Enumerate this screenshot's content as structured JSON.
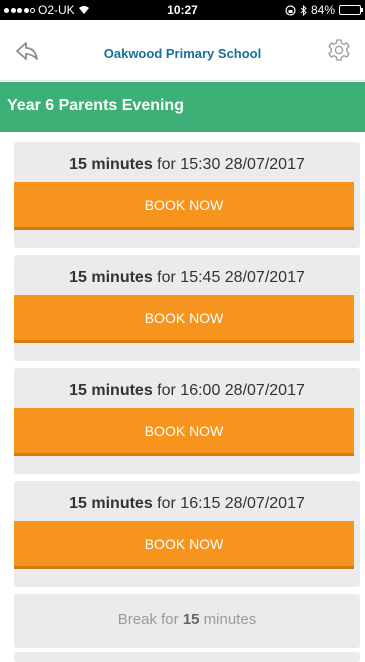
{
  "status_bar": {
    "carrier": "O2-UK",
    "time": "10:27",
    "battery": "84%",
    "battery_level": 0.84
  },
  "nav": {
    "title": "Oakwood Primary School",
    "back_icon": "back-arrow-icon",
    "settings_icon": "gear-icon",
    "title_color": "#1b6e96"
  },
  "header": {
    "title": "Year 6 Parents Evening",
    "color": "#3db077"
  },
  "slots": [
    {
      "duration": "15 minutes",
      "for_word": "for",
      "time": "15:30 28/07/2017",
      "button_label": "BOOK NOW"
    },
    {
      "duration": "15 minutes",
      "for_word": "for",
      "time": "15:45 28/07/2017",
      "button_label": "BOOK NOW"
    },
    {
      "duration": "15 minutes",
      "for_word": "for",
      "time": "16:00 28/07/2017",
      "button_label": "BOOK NOW"
    },
    {
      "duration": "15 minutes",
      "for_word": "for",
      "time": "16:15 28/07/2017",
      "button_label": "BOOK NOW"
    }
  ],
  "break": {
    "prefix": "Break for",
    "duration": "15",
    "suffix": "minutes"
  },
  "colors": {
    "button": "#f7941e",
    "card": "#ebebeb"
  }
}
